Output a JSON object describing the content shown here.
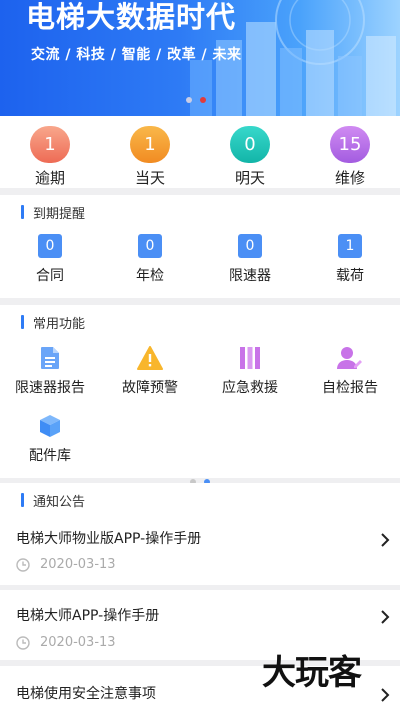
{
  "banner": {
    "title": "电梯大数据时代",
    "subtitle": "交流 / 科技 / 智能 / 改革 / 未来"
  },
  "counters": [
    {
      "value": "1",
      "label": "逾期"
    },
    {
      "value": "1",
      "label": "当天"
    },
    {
      "value": "0",
      "label": "明天"
    },
    {
      "value": "15",
      "label": "维修"
    }
  ],
  "expiry": {
    "title": "到期提醒",
    "items": [
      {
        "value": "0",
        "label": "合同"
      },
      {
        "value": "0",
        "label": "年检"
      },
      {
        "value": "0",
        "label": "限速器"
      },
      {
        "value": "1",
        "label": "载荷"
      }
    ]
  },
  "functions": {
    "title": "常用功能",
    "items": [
      {
        "label": "限速器报告",
        "icon": "document-icon"
      },
      {
        "label": "故障预警",
        "icon": "warning-icon"
      },
      {
        "label": "应急救援",
        "icon": "books-icon"
      },
      {
        "label": "自检报告",
        "icon": "user-edit-icon"
      },
      {
        "label": "配件库",
        "icon": "cube-icon"
      }
    ]
  },
  "notices": {
    "title": "通知公告",
    "items": [
      {
        "title": "电梯大师物业版APP-操作手册",
        "date": "2020-03-13"
      },
      {
        "title": "电梯大师APP-操作手册",
        "date": "2020-03-13"
      },
      {
        "title": "电梯使用安全注意事项"
      }
    ]
  },
  "watermark": "大玩客",
  "colors": {
    "accent": "#2e7bf5",
    "banner_start": "#1d62ee",
    "overdue": "#ee6b55",
    "today": "#f18b22",
    "tomorrow": "#13b5a8",
    "repair": "#a35ce0"
  }
}
